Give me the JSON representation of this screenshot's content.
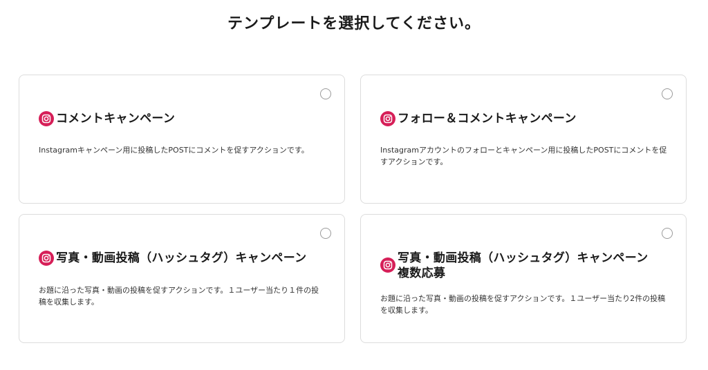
{
  "page": {
    "title": "テンプレートを選択してください。"
  },
  "colors": {
    "instagram_badge": "#d61f58",
    "card_border": "#dcdcdc",
    "radio_border": "#9a9a9a"
  },
  "templates": [
    {
      "icon": "instagram-icon",
      "title": "コメントキャンペーン",
      "description": "Instagramキャンペーン用に投稿したPOSTにコメントを促すアクションです。",
      "selected": false
    },
    {
      "icon": "instagram-icon",
      "title": "フォロー＆コメントキャンペーン",
      "description": "Instagramアカウントのフォローとキャンペーン用に投稿したPOSTにコメントを促すアクションです。",
      "selected": false
    },
    {
      "icon": "instagram-icon",
      "title": "写真・動画投稿（ハッシュタグ）キャンペーン",
      "description": "お題に沿った写真・動画の投稿を促すアクションです。１ユーザー当たり１件の投稿を収集します。",
      "selected": false
    },
    {
      "icon": "instagram-icon",
      "title": "写真・動画投稿（ハッシュタグ）キャンペーン複数応募",
      "description": "お題に沿った写真・動画の投稿を促すアクションです。１ユーザー当たり2件の投稿を収集します。",
      "selected": false
    }
  ]
}
